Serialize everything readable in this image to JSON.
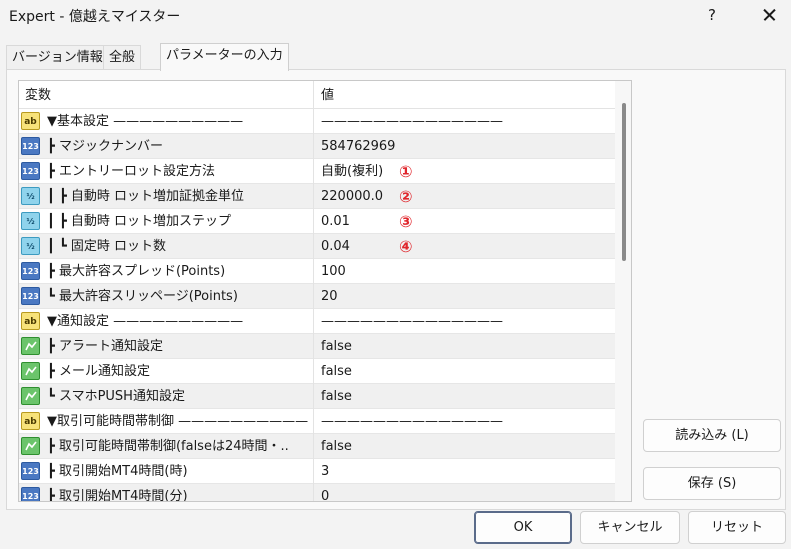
{
  "window": {
    "title": "Expert - 億越えマイスター",
    "help_label": "?",
    "close_label": "✕"
  },
  "tabs": [
    {
      "label": "バージョン情報"
    },
    {
      "label": "全般"
    },
    {
      "label": "パラメーターの入力"
    }
  ],
  "grid": {
    "col_variable": "変数",
    "col_value": "値",
    "rows": [
      {
        "icon": "ab-icon",
        "name": "▼基本設定 ——————————",
        "value": "——————————————",
        "marker": ""
      },
      {
        "icon": "int-icon",
        "name": "┣ マジックナンバー",
        "value": "584762969",
        "marker": ""
      },
      {
        "icon": "int-icon",
        "name": "┣ エントリーロット設定方法",
        "value": "自動(複利)",
        "marker": "①"
      },
      {
        "icon": "dbl-icon",
        "name": "┃ ┣ 自動時 ロット増加証拠金単位",
        "value": "220000.0",
        "marker": "②"
      },
      {
        "icon": "dbl-icon",
        "name": "┃ ┣ 自動時 ロット増加ステップ",
        "value": "0.01",
        "marker": "③"
      },
      {
        "icon": "dbl-icon",
        "name": "┃ ┗ 固定時 ロット数",
        "value": "0.04",
        "marker": "④"
      },
      {
        "icon": "int-icon",
        "name": "┣ 最大許容スプレッド(Points)",
        "value": "100",
        "marker": ""
      },
      {
        "icon": "int-icon",
        "name": "┗ 最大許容スリッページ(Points)",
        "value": "20",
        "marker": ""
      },
      {
        "icon": "ab-icon",
        "name": "▼通知設定 ——————————",
        "value": "——————————————",
        "marker": ""
      },
      {
        "icon": "bool-icon",
        "name": "┣ アラート通知設定",
        "value": "false",
        "marker": ""
      },
      {
        "icon": "bool-icon",
        "name": "┣ メール通知設定",
        "value": "false",
        "marker": ""
      },
      {
        "icon": "bool-icon",
        "name": "┗ スマホPUSH通知設定",
        "value": "false",
        "marker": ""
      },
      {
        "icon": "ab-icon",
        "name": "▼取引可能時間帯制御 ——————————・..",
        "value": "——————————————",
        "marker": ""
      },
      {
        "icon": "bool-icon",
        "name": "┣ 取引可能時間帯制御(falseは24時間・..",
        "value": "false",
        "marker": ""
      },
      {
        "icon": "int-icon",
        "name": "┣ 取引開始MT4時間(時)",
        "value": "3",
        "marker": ""
      },
      {
        "icon": "int-icon",
        "name": "┣ 取引開始MT4時間(分)",
        "value": "0",
        "marker": ""
      }
    ]
  },
  "buttons": {
    "load": "読み込み (L)",
    "save": "保存 (S)",
    "ok": "OK",
    "cancel": "キャンセル",
    "reset": "リセット"
  }
}
